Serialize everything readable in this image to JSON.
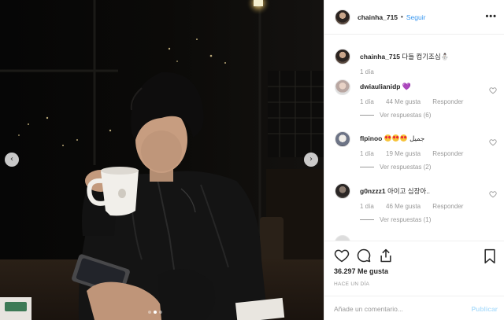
{
  "post": {
    "author": "chainha_715",
    "follow_label": "Seguir",
    "separator": "•",
    "more_label": "•••",
    "caption": "다들 컴기조심⛄",
    "caption_age": "1 día"
  },
  "comments": [
    {
      "username": "dwiaulianidp",
      "text": "",
      "emoji": "purple-heart",
      "age": "1 día",
      "likes": "44 Me gusta",
      "reply_label": "Responder",
      "view_replies": "Ver respuestas (6)"
    },
    {
      "username": "flpinoo",
      "text": "جميل",
      "emoji": "heart-eyes-x3",
      "age": "1 día",
      "likes": "19 Me gusta",
      "reply_label": "Responder",
      "view_replies": "Ver respuestas (2)"
    },
    {
      "username": "g0nzzz1",
      "text": "아이고 심장아..",
      "emoji": "",
      "age": "1 día",
      "likes": "46 Me gusta",
      "reply_label": "Responder",
      "view_replies": "Ver respuestas (1)"
    }
  ],
  "footer": {
    "likes_count": "36.297 Me gusta",
    "posted_ago": "HACE UN DÍA",
    "comment_placeholder": "Añade un comentario...",
    "publish_label": "Publicar"
  },
  "icons": {
    "like": "heart-outline-icon",
    "comment": "speech-bubble-icon",
    "share": "share-icon",
    "save": "bookmark-icon",
    "prev": "chevron-left-icon",
    "next": "chevron-right-icon"
  },
  "carousel": {
    "slides": 3,
    "active_index": 1
  },
  "colors": {
    "link": "#3897f0",
    "muted": "#999999",
    "publish_disabled": "#b2dffc"
  }
}
